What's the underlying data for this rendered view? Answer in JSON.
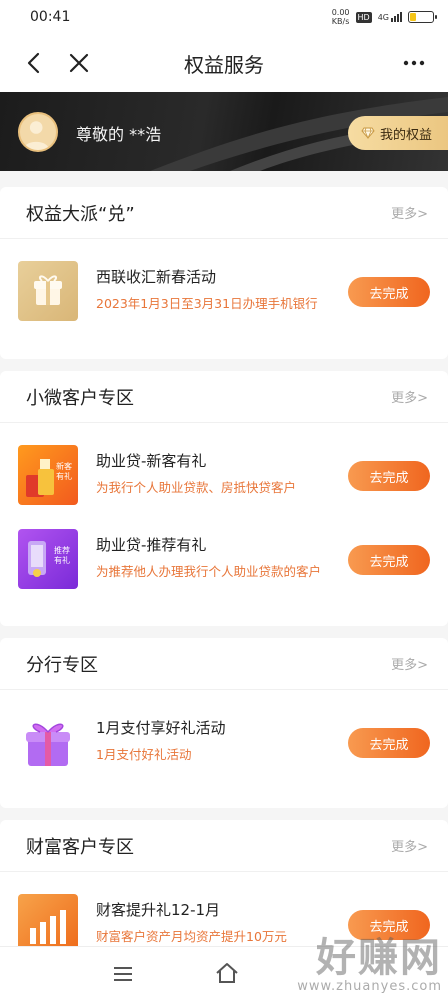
{
  "status_bar": {
    "time": "00:41",
    "speed_value": "0.00",
    "speed_unit": "KB/s",
    "hd": "HD",
    "network": "4G",
    "battery_level": 0.25,
    "battery_color": "#f5c518"
  },
  "nav": {
    "title": "权益服务",
    "back_icon": "chevron-left-icon",
    "close_icon": "close-icon",
    "more_icon": "more-dots-icon"
  },
  "user": {
    "greeting": "尊敬的 **浩",
    "rights_button": "我的权益"
  },
  "sections": [
    {
      "title": "权益大派“兑”",
      "more": "更多>",
      "items": [
        {
          "title": "西联收汇新春活动",
          "desc": "2023年1月3日至3月31日办理手机银行",
          "button": "去完成",
          "thumb": "gift-box-icon"
        }
      ]
    },
    {
      "title": "小微客户专区",
      "more": "更多>",
      "items": [
        {
          "title": "助业贷-新客有礼",
          "desc": "为我行个人助业贷款、房抵快贷客户",
          "button": "去完成",
          "thumb": "new-customer-gift-icon",
          "thumb_text": "新客有礼"
        },
        {
          "title": "助业贷-推荐有礼",
          "desc": "为推荐他人办理我行个人助业贷款的客户",
          "button": "去完成",
          "thumb": "referral-gift-icon",
          "thumb_text": "推荐有礼"
        }
      ]
    },
    {
      "title": "分行专区",
      "more": "更多>",
      "items": [
        {
          "title": "1月支付享好礼活动",
          "desc": "1月支付好礼活动",
          "button": "去完成",
          "thumb": "purple-gift-icon"
        }
      ]
    },
    {
      "title": "财富客户专区",
      "more": "更多>",
      "items": [
        {
          "title": "财客提升礼12-1月",
          "desc": "财富客户资产月均资产提升10万元",
          "button": "去完成",
          "thumb": "bar-chart-icon"
        }
      ]
    }
  ],
  "bottom_bar": {
    "menu_icon": "menu-icon",
    "home_icon": "home-icon"
  },
  "watermark": {
    "cn": "好赚网",
    "en": "www.zhuanyes.com"
  },
  "colors": {
    "accent_orange": "#f0661f",
    "gold": "#e9c27a",
    "desc_orange": "#e8763a"
  }
}
